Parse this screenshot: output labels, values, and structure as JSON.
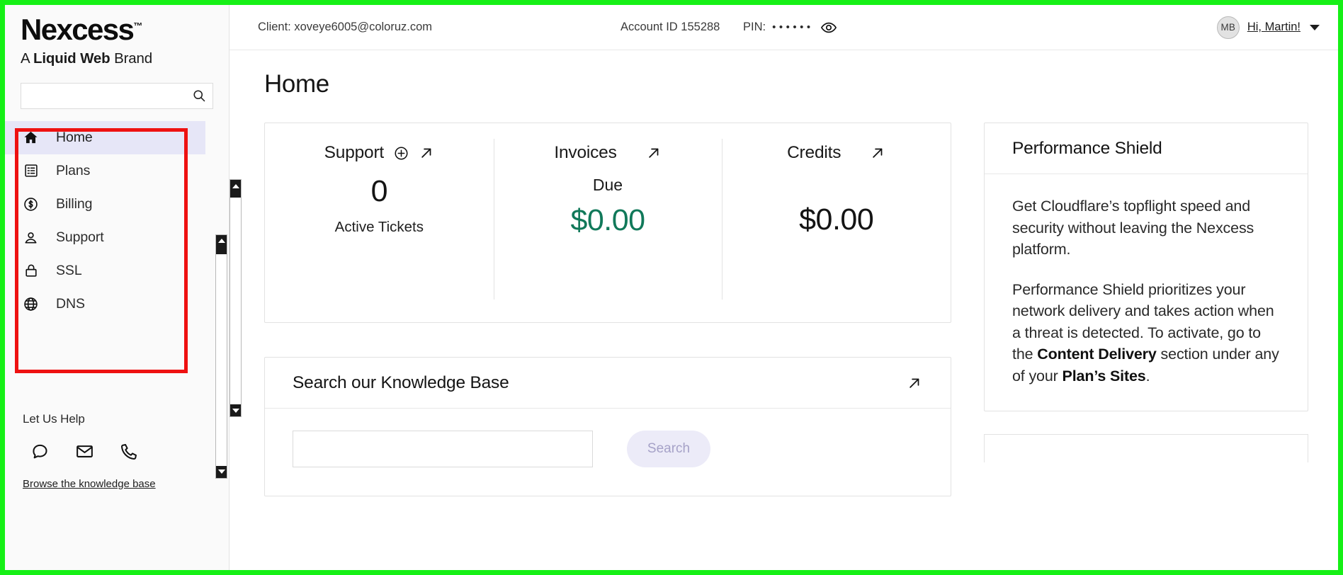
{
  "brand": {
    "name": "Nexcess",
    "tm": "™",
    "tagline_prefix": "A ",
    "tagline_bold": "Liquid Web",
    "tagline_suffix": " Brand"
  },
  "sidebar": {
    "search_placeholder": "",
    "search_value": "",
    "search_icon": "search-icon",
    "items": [
      {
        "label": "Home",
        "icon": "home-icon",
        "active": true
      },
      {
        "label": "Plans",
        "icon": "list-icon",
        "active": false
      },
      {
        "label": "Billing",
        "icon": "dollar-circle-icon",
        "active": false
      },
      {
        "label": "Support",
        "icon": "user-support-icon",
        "active": false
      },
      {
        "label": "SSL",
        "icon": "lock-icon",
        "active": false
      },
      {
        "label": "DNS",
        "icon": "globe-icon",
        "active": false
      }
    ],
    "help": {
      "title": "Let Us Help",
      "icons": [
        "chat-bubble-icon",
        "envelope-icon",
        "phone-icon"
      ],
      "link": "Browse the knowledge base"
    }
  },
  "topbar": {
    "client_label": "Client: xoveye6005@coloruz.com",
    "account_label": "Account ID 155288",
    "pin_label": "PIN:",
    "pin_masked": "••••••",
    "eye_icon": "eye-icon",
    "avatar_initials": "MB",
    "greeting": "Hi, Martin!",
    "chevron_icon": "chevron-down-icon"
  },
  "page": {
    "title": "Home"
  },
  "stats": [
    {
      "title": "Support",
      "add_icon": "plus-circle-icon",
      "link_icon": "arrow-up-right-icon",
      "sublabel": "",
      "value": "0",
      "value_color": "#141414",
      "caption": "Active Tickets"
    },
    {
      "title": "Invoices",
      "add_icon": "",
      "link_icon": "arrow-up-right-icon",
      "sublabel": "Due",
      "value": "$0.00",
      "value_color": "#11795a",
      "caption": ""
    },
    {
      "title": "Credits",
      "add_icon": "",
      "link_icon": "arrow-up-right-icon",
      "sublabel": "",
      "value": "$0.00",
      "value_color": "#141414",
      "caption": ""
    }
  ],
  "knowledge_base": {
    "title": "Search our Knowledge Base",
    "link_icon": "arrow-up-right-icon",
    "input_value": "",
    "input_placeholder": "",
    "button_label": "Search"
  },
  "performance_shield": {
    "title": "Performance Shield",
    "paragraph_1": "Get Cloudflare’s topflight speed and security without leaving the Nexcess platform.",
    "paragraph_2_parts": [
      {
        "text": "Performance Shield prioritizes your network delivery and takes action when a threat is detected. To activate, go to the ",
        "bold": false
      },
      {
        "text": "Content Delivery",
        "bold": true
      },
      {
        "text": " section under any of your ",
        "bold": false
      },
      {
        "text": "Plan’s Sites",
        "bold": true
      },
      {
        "text": ".",
        "bold": false
      }
    ]
  },
  "annotations": {
    "highlight_box_color": "#ee1111",
    "frame_color": "#16f016"
  },
  "colors": {
    "active_nav_bg": "#e6e6f7",
    "money_green": "#11795a",
    "search_button_bg": "#ecebf8",
    "search_button_text": "#a6a2c8"
  }
}
